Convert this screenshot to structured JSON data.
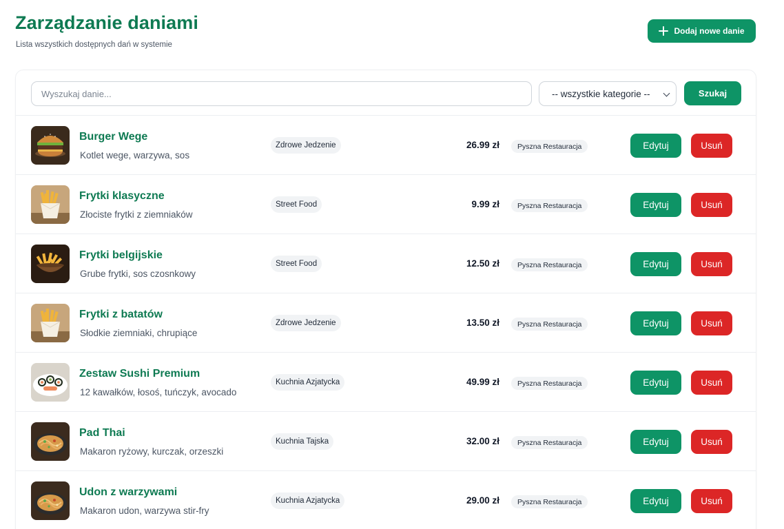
{
  "header": {
    "title": "Zarządzanie daniami",
    "subtitle": "Lista wszystkich dostępnych dań w systemie",
    "add_button_label": "Dodaj nowe danie"
  },
  "filters": {
    "search_placeholder": "Wyszukaj danie...",
    "search_value": "",
    "category_selected": "-- wszystkie kategorie --",
    "search_button_label": "Szukaj"
  },
  "actions": {
    "edit_label": "Edytuj",
    "delete_label": "Usuń"
  },
  "colors": {
    "accent": "#0e9466",
    "title": "#0e7a52",
    "danger": "#dc2626"
  },
  "dishes": [
    {
      "name": "Burger Wege",
      "description": "Kotlet wege, warzywa, sos",
      "category": "Zdrowe Jedzenie",
      "price": "26.99 zł",
      "restaurant": "Pyszna Restauracja",
      "image": "burger-photo"
    },
    {
      "name": "Frytki klasyczne",
      "description": "Złociste frytki z ziemniaków",
      "category": "Street Food",
      "price": "9.99 zł",
      "restaurant": "Pyszna Restauracja",
      "image": "fries-photo"
    },
    {
      "name": "Frytki belgijskie",
      "description": "Grube frytki, sos czosnkowy",
      "category": "Street Food",
      "price": "12.50 zł",
      "restaurant": "Pyszna Restauracja",
      "image": "fries-bowl-photo"
    },
    {
      "name": "Frytki z batatów",
      "description": "Słodkie ziemniaki, chrupiące",
      "category": "Zdrowe Jedzenie",
      "price": "13.50 zł",
      "restaurant": "Pyszna Restauracja",
      "image": "fries-photo"
    },
    {
      "name": "Zestaw Sushi Premium",
      "description": "12 kawałków, łosoś, tuńczyk, avocado",
      "category": "Kuchnia Azjatycka",
      "price": "49.99 zł",
      "restaurant": "Pyszna Restauracja",
      "image": "sushi-photo"
    },
    {
      "name": "Pad Thai",
      "description": "Makaron ryżowy, kurczak, orzeszki",
      "category": "Kuchnia Tajska",
      "price": "32.00 zł",
      "restaurant": "Pyszna Restauracja",
      "image": "noodles-photo"
    },
    {
      "name": "Udon z warzywami",
      "description": "Makaron udon, warzywa stir-fry",
      "category": "Kuchnia Azjatycka",
      "price": "29.00 zł",
      "restaurant": "Pyszna Restauracja",
      "image": "noodles-photo"
    }
  ]
}
